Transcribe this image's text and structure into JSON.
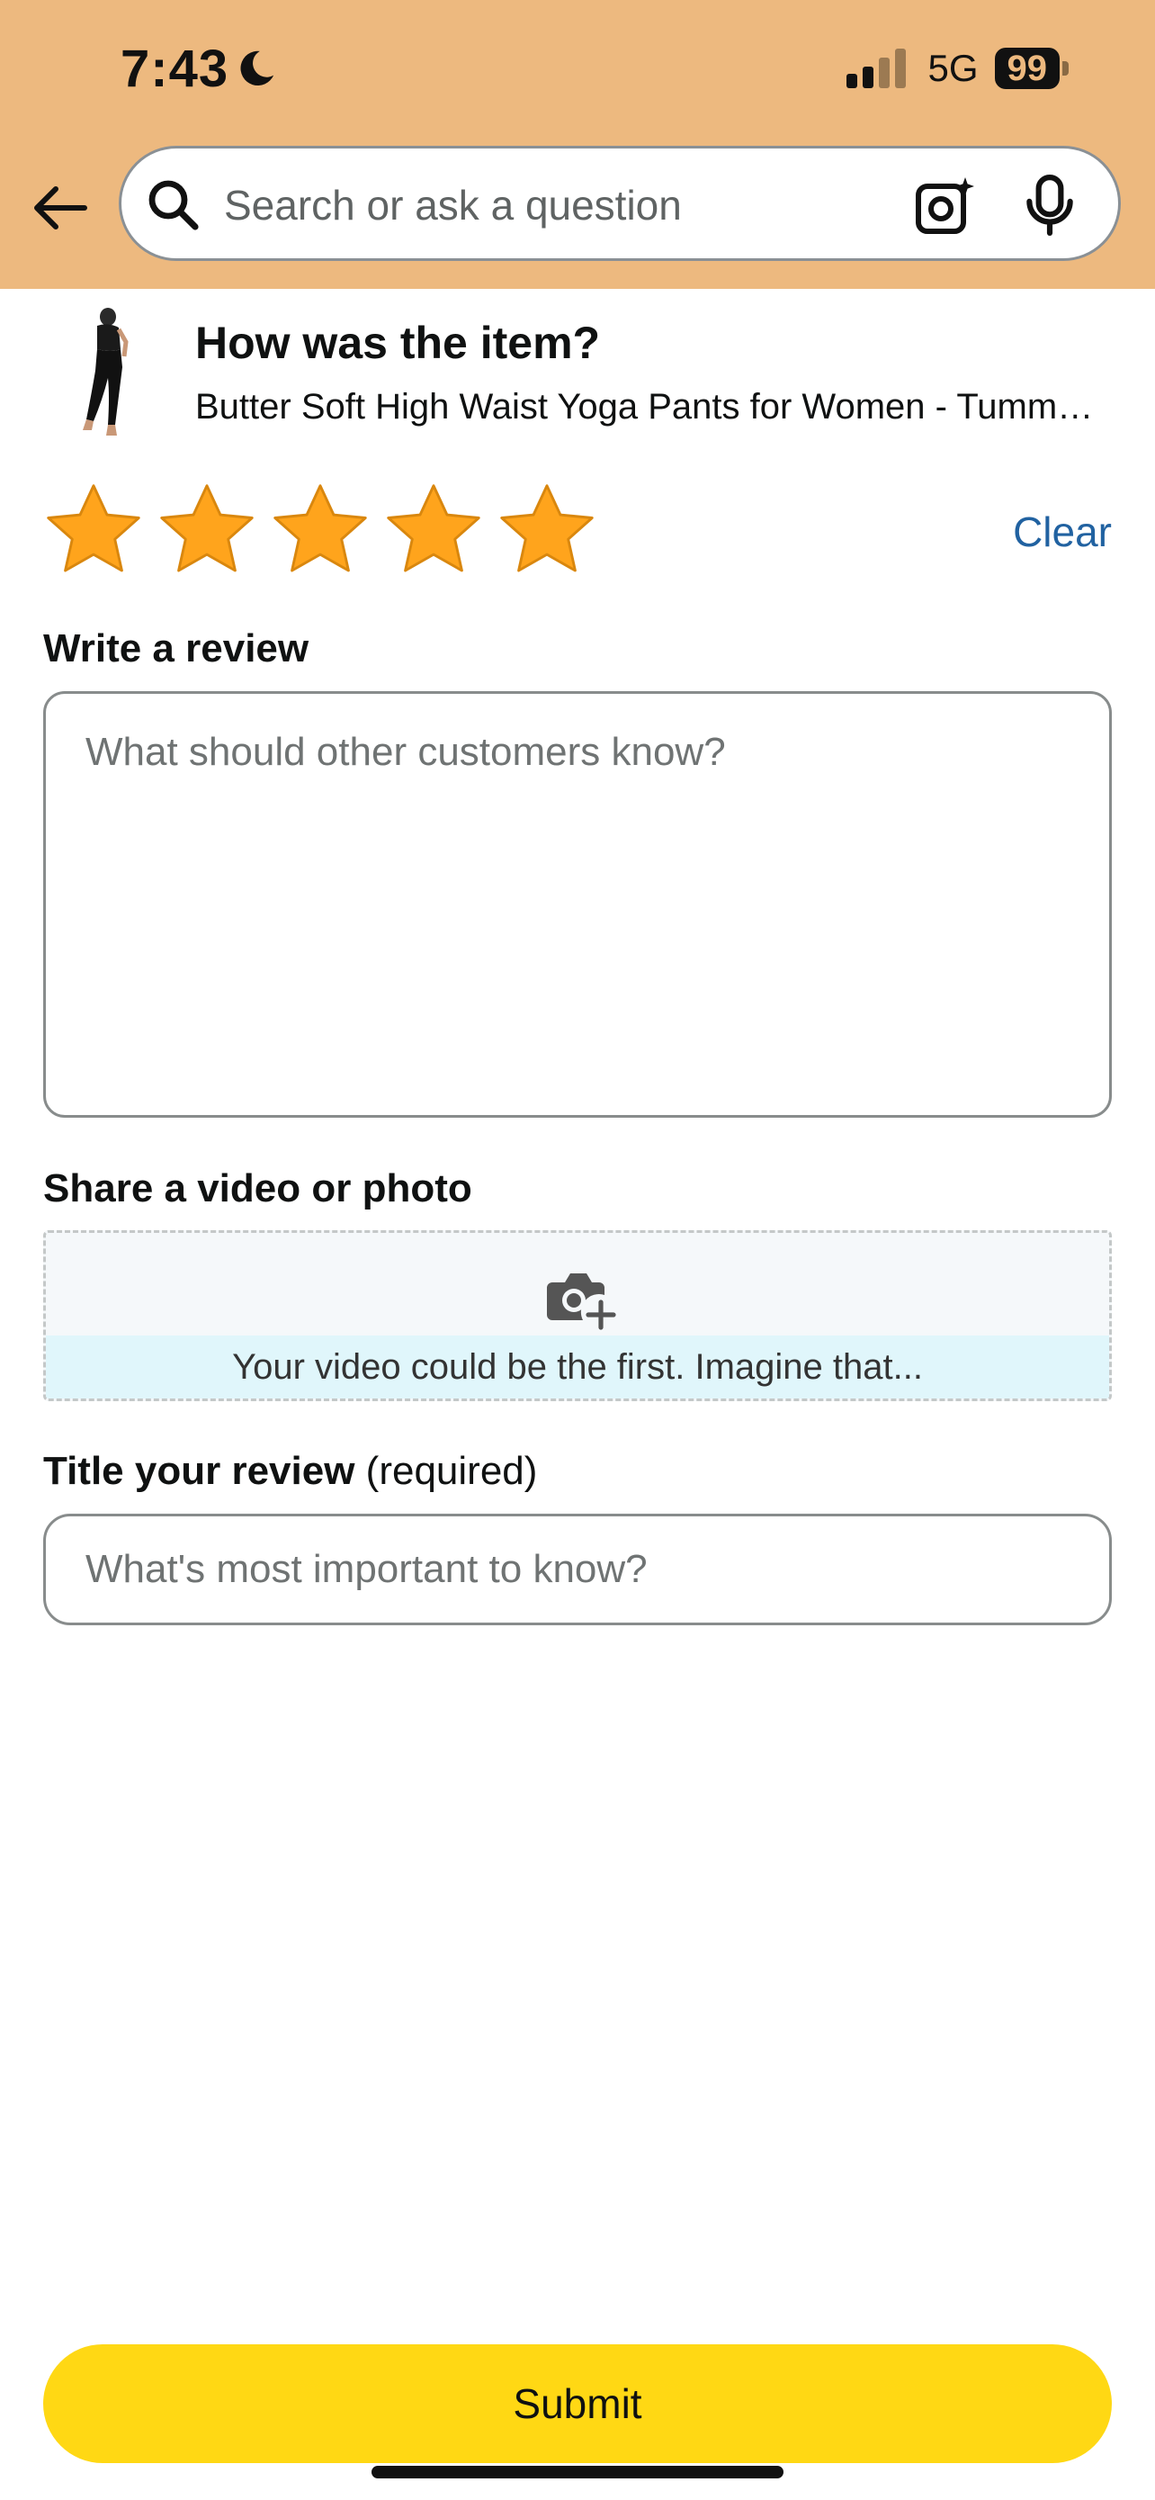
{
  "status_bar": {
    "time": "7:43",
    "network": "5G",
    "battery": "99"
  },
  "search": {
    "placeholder": "Search or ask a question"
  },
  "product": {
    "prompt": "How was the item?",
    "name": "Butter Soft High Waist Yoga Pants for Women - Tummy Control Workout Running Leggings"
  },
  "rating": {
    "stars_selected": 5,
    "stars_total": 5,
    "clear_label": "Clear",
    "star_color": "#FFA41C"
  },
  "review": {
    "label": "Write a review",
    "placeholder": "What should other customers know?"
  },
  "media": {
    "label": "Share a video or photo",
    "hint": "Your video could be the first. Imagine that..."
  },
  "title_field": {
    "label": "Title your review",
    "required_note": "(required)",
    "placeholder": "What's most important to know?"
  },
  "submit": {
    "label": "Submit",
    "color": "#FFD814"
  },
  "icons": [
    "moon-icon",
    "signal-icon",
    "back-arrow-icon",
    "search-icon",
    "camera-search-icon",
    "microphone-icon",
    "star-icon",
    "camera-add-icon"
  ],
  "colors": {
    "header_bg": "#EDB97F",
    "link": "#2162A1"
  }
}
